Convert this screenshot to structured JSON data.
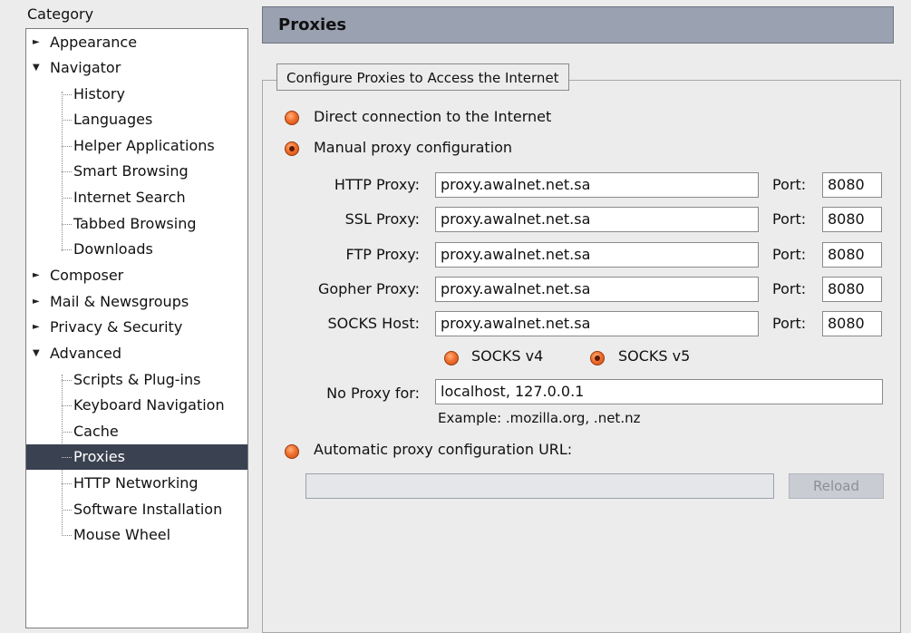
{
  "sidebar": {
    "title": "Category",
    "items": [
      {
        "label": "Appearance",
        "level": 0,
        "expander": "collapsed"
      },
      {
        "label": "Navigator",
        "level": 0,
        "expander": "expanded"
      },
      {
        "label": "History",
        "level": 1
      },
      {
        "label": "Languages",
        "level": 1
      },
      {
        "label": "Helper Applications",
        "level": 1
      },
      {
        "label": "Smart Browsing",
        "level": 1
      },
      {
        "label": "Internet Search",
        "level": 1
      },
      {
        "label": "Tabbed Browsing",
        "level": 1
      },
      {
        "label": "Downloads",
        "level": 1
      },
      {
        "label": "Composer",
        "level": 0,
        "expander": "collapsed"
      },
      {
        "label": "Mail & Newsgroups",
        "level": 0,
        "expander": "collapsed"
      },
      {
        "label": "Privacy & Security",
        "level": 0,
        "expander": "collapsed"
      },
      {
        "label": "Advanced",
        "level": 0,
        "expander": "expanded"
      },
      {
        "label": "Scripts & Plug-ins",
        "level": 1
      },
      {
        "label": "Keyboard Navigation",
        "level": 1
      },
      {
        "label": "Cache",
        "level": 1
      },
      {
        "label": "Proxies",
        "level": 1,
        "selected": true
      },
      {
        "label": "HTTP Networking",
        "level": 1
      },
      {
        "label": "Software Installation",
        "level": 1
      },
      {
        "label": "Mouse Wheel",
        "level": 1
      }
    ]
  },
  "panel": {
    "title": "Proxies",
    "group_title": "Configure Proxies to Access the Internet",
    "options": {
      "direct": {
        "label": "Direct connection to the Internet",
        "checked": false
      },
      "manual": {
        "label": "Manual proxy configuration",
        "checked": true
      },
      "auto": {
        "label": "Automatic proxy configuration URL:",
        "checked": false
      }
    },
    "fields": [
      {
        "label": "HTTP Proxy:",
        "value": "proxy.awalnet.net.sa",
        "port_label": "Port:",
        "port": "8080"
      },
      {
        "label": "SSL Proxy:",
        "value": "proxy.awalnet.net.sa",
        "port_label": "Port:",
        "port": "8080"
      },
      {
        "label": "FTP Proxy:",
        "value": "proxy.awalnet.net.sa",
        "port_label": "Port:",
        "port": "8080"
      },
      {
        "label": "Gopher Proxy:",
        "value": "proxy.awalnet.net.sa",
        "port_label": "Port:",
        "port": "8080"
      },
      {
        "label": "SOCKS Host:",
        "value": "proxy.awalnet.net.sa",
        "port_label": "Port:",
        "port": "8080"
      }
    ],
    "socks": {
      "v4": {
        "label": "SOCKS v4",
        "checked": false
      },
      "v5": {
        "label": "SOCKS v5",
        "checked": true
      }
    },
    "no_proxy": {
      "label": "No Proxy for:",
      "value": "localhost, 127.0.0.1"
    },
    "example": "Example: .mozilla.org, .net.nz",
    "auto_url_value": "",
    "reload_label": "Reload"
  },
  "colors": {
    "selection": "#3a4150",
    "header_bg": "#9aa1b0",
    "radio": "#f07030"
  }
}
